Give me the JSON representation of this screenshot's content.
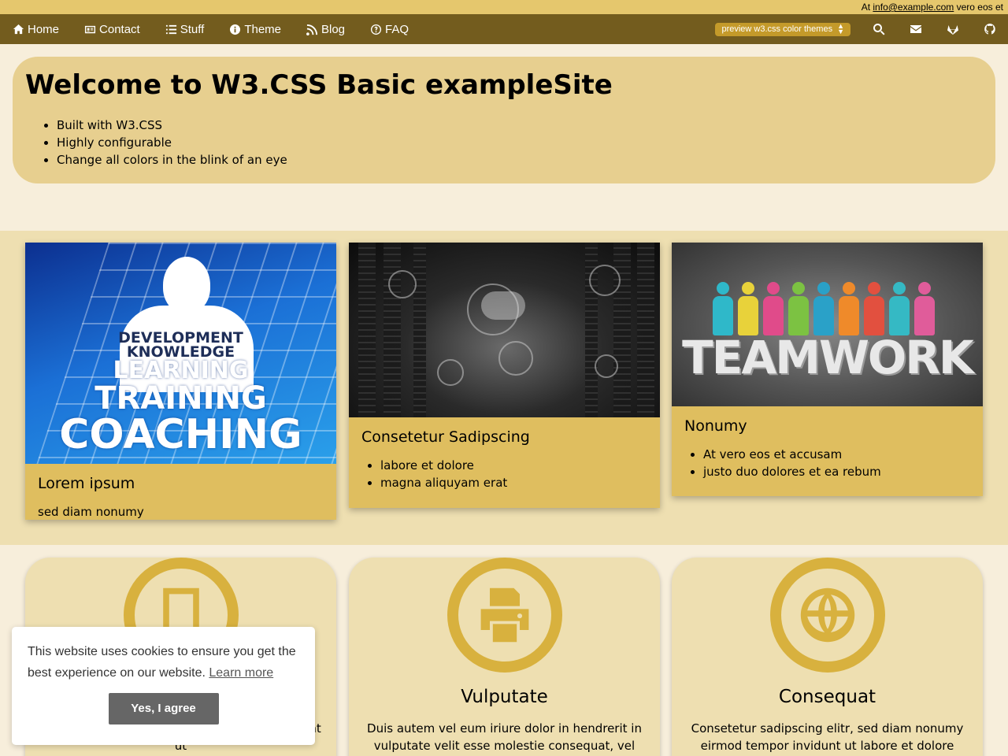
{
  "topbar": {
    "prefix": "At",
    "email": "info@example.com",
    "suffix": "vero eos et"
  },
  "nav": {
    "items": [
      {
        "label": "Home",
        "icon": "home-icon"
      },
      {
        "label": "Contact",
        "icon": "contact-card-icon"
      },
      {
        "label": "Stuff",
        "icon": "list-icon"
      },
      {
        "label": "Theme",
        "icon": "info-icon"
      },
      {
        "label": "Blog",
        "icon": "rss-icon"
      },
      {
        "label": "FAQ",
        "icon": "question-icon"
      }
    ],
    "theme_select": "preview w3.css color themes",
    "right_icons": [
      "search-icon",
      "envelope-icon",
      "gitlab-icon",
      "github-icon"
    ],
    "colors": {
      "bar": "#735c1e",
      "strip": "#e5c76d"
    }
  },
  "hero": {
    "title": "Welcome to W3.CSS Basic exampleSite",
    "bullets": [
      "Built with W3.CSS",
      "Highly configurable",
      "Change all colors in the blink of an eye"
    ]
  },
  "cards": [
    {
      "image_text": [
        "DEVELOPMENT",
        "KNOWLEDGE",
        "LEARNING",
        "TRAINING",
        "COACHING"
      ],
      "title": "Lorem ipsum",
      "text": "sed diam nonumy"
    },
    {
      "title": "Consetetur Sadipscing",
      "bullets": [
        "labore et dolore",
        "magna aliquyam erat"
      ]
    },
    {
      "image_text": "TEAMWORK",
      "title": "Nonumy",
      "bullets": [
        "At vero eos et accusam",
        "justo duo dolores et ea rebum"
      ]
    }
  ],
  "features": [
    {
      "icon": "tablet-icon",
      "title": "",
      "text": "elitr, sed diam nonumy eirmod tempor invidunt ut"
    },
    {
      "icon": "printer-icon",
      "title": "Vulputate",
      "text": "Duis autem vel eum iriure dolor in hendrerit in vulputate velit esse molestie consequat, vel illum"
    },
    {
      "icon": "globe-icon",
      "title": "Consequat",
      "text": "Consetetur sadipscing elitr, sed diam nonumy eirmod tempor invidunt ut labore et dolore magna aliquyam"
    }
  ],
  "cookie": {
    "message": "This website uses cookies to ensure you get the best experience on our website.",
    "learn_more": "Learn more",
    "agree": "Yes, I agree"
  }
}
